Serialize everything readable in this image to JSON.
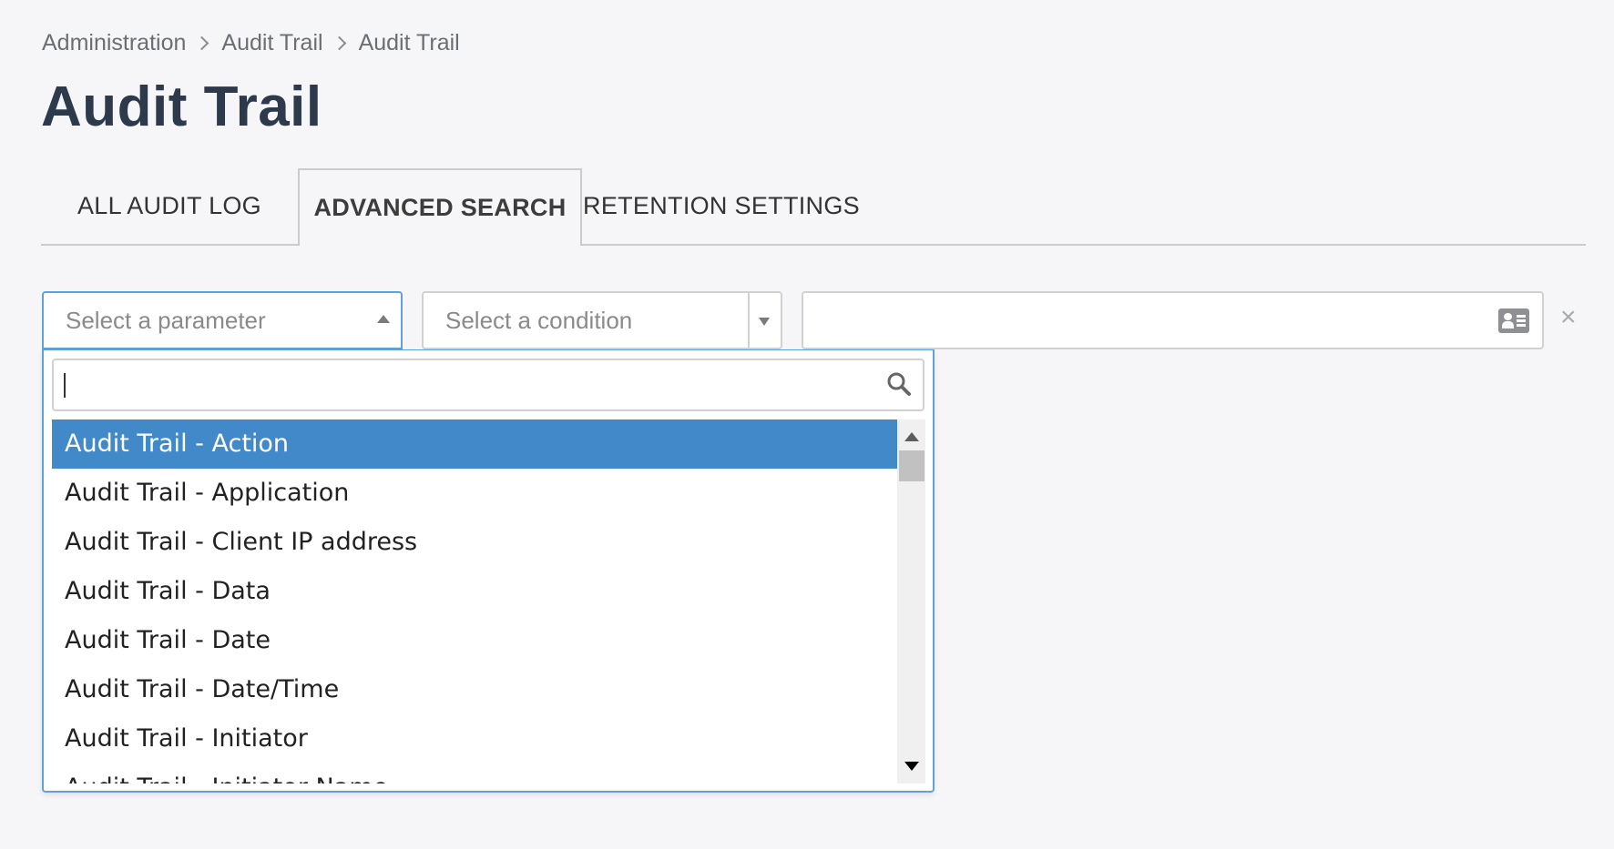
{
  "breadcrumb": {
    "items": [
      "Administration",
      "Audit Trail",
      "Audit Trail"
    ]
  },
  "page": {
    "title": "Audit Trail"
  },
  "tabs": [
    {
      "label": "ALL AUDIT LOG",
      "active": false
    },
    {
      "label": "ADVANCED SEARCH",
      "active": true
    },
    {
      "label": "RETENTION SETTINGS",
      "active": false
    }
  ],
  "filter": {
    "parameter_placeholder": "Select a parameter",
    "condition_placeholder": "Select a condition",
    "value": "",
    "value_icon": "contact-card-icon",
    "remove_icon": "close-icon",
    "remove_glyph": "×"
  },
  "dropdown": {
    "search_value": "",
    "search_icon": "search-icon",
    "selected_index": 0,
    "options": [
      "Audit Trail - Action",
      "Audit Trail - Application",
      "Audit Trail - Client IP address",
      "Audit Trail - Data",
      "Audit Trail - Date",
      "Audit Trail - Date/Time",
      "Audit Trail - Initiator",
      "Audit Trail - Initiator Name"
    ]
  },
  "colors": {
    "accent": "#4189c8",
    "focus_border": "#5ea1dc",
    "title": "#2c3a4b",
    "background": "#f6f6f8"
  }
}
